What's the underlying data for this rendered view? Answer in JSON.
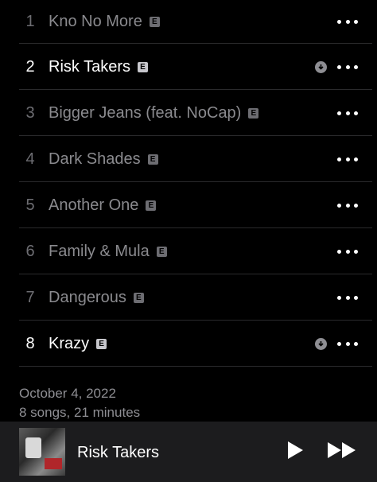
{
  "tracks": [
    {
      "number": "1",
      "title": "Kno No More",
      "explicit_badge": "E",
      "downloaded": false
    },
    {
      "number": "2",
      "title": "Risk Takers",
      "explicit_badge": "E",
      "downloaded": true
    },
    {
      "number": "3",
      "title": "Bigger Jeans (feat. NoCap)",
      "explicit_badge": "E",
      "downloaded": false
    },
    {
      "number": "4",
      "title": "Dark Shades",
      "explicit_badge": "E",
      "downloaded": false
    },
    {
      "number": "5",
      "title": "Another One",
      "explicit_badge": "E",
      "downloaded": false
    },
    {
      "number": "6",
      "title": "Family & Mula",
      "explicit_badge": "E",
      "downloaded": false
    },
    {
      "number": "7",
      "title": "Dangerous",
      "explicit_badge": "E",
      "downloaded": false
    },
    {
      "number": "8",
      "title": "Krazy",
      "explicit_badge": "E",
      "downloaded": true
    }
  ],
  "album_info": {
    "release_date": "October 4, 2022",
    "summary": "8 songs, 21 minutes"
  },
  "now_playing": {
    "title": "Risk Takers",
    "icons": {
      "play": "play-icon",
      "next": "fast-forward-icon"
    }
  },
  "icons": {
    "more": "more-icon",
    "downloaded": "downloaded-icon"
  },
  "colors": {
    "background": "#000000",
    "miniplayer_background": "#1c1c1e",
    "dimmed_text": "#8a8a8e",
    "active_text": "#ffffff"
  }
}
